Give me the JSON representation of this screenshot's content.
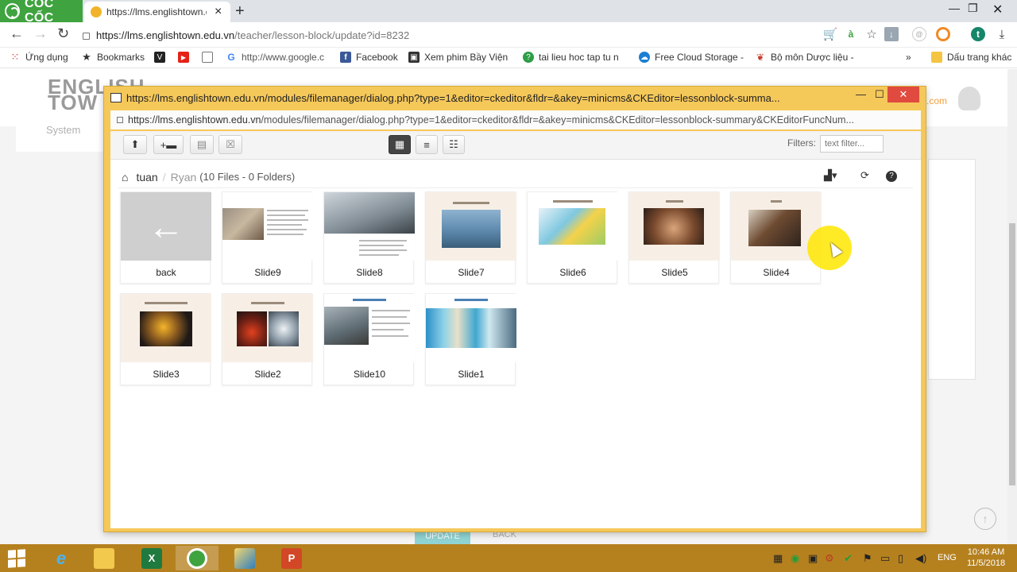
{
  "browser": {
    "brand": "CỐC CỐC",
    "tab_title": "https://lms.englishtown.e",
    "url_host": "https://lms.englishtown.edu.vn",
    "url_path": "/teacher/lesson-block/update?id=8232",
    "account_initial": "t",
    "cart_letter": "à"
  },
  "bookmarks": [
    {
      "label": "Ứng dụng",
      "icon": "apps-grid-icon"
    },
    {
      "label": "Bookmarks",
      "icon": "star-icon"
    },
    {
      "label": "",
      "icon": "v-logo-icon"
    },
    {
      "label": "",
      "icon": "youtube-icon"
    },
    {
      "label": "",
      "icon": "page-icon"
    },
    {
      "label": "http://www.google.c",
      "icon": "google-icon"
    },
    {
      "label": "Facebook",
      "icon": "facebook-icon"
    },
    {
      "label": "Xem phim Bầy Viện",
      "icon": "video-icon"
    },
    {
      "label": "tai lieu hoc tap tu n",
      "icon": "green-circle-icon"
    },
    {
      "label": "Free Cloud Storage -",
      "icon": "cloud-icon"
    },
    {
      "label": "Bộ môn Dược liệu -",
      "icon": "leaf-icon"
    },
    {
      "label": "Dấu trang khác",
      "icon": "folder-icon"
    }
  ],
  "background_page": {
    "logo_line1": "ENGLISH",
    "logo_line2": "TOW",
    "menu_system": "System",
    "domain_fragment": ".com",
    "update_label": "UPDATE",
    "back_label": "BACK"
  },
  "popup": {
    "title": "https://lms.englishtown.edu.vn/modules/filemanager/dialog.php?type=1&editor=ckeditor&fldr=&akey=minicms&CKEditor=lessonblock-summa...",
    "url_host": "https://lms.englishtown.edu.vn",
    "url_path": "/modules/filemanager/dialog.php?type=1&editor=ckeditor&fldr=&akey=minicms&CKEditor=lessonblock-summary&CKEditorFuncNum..."
  },
  "filemanager": {
    "filters_label": "Filters:",
    "filter_placeholder": "text filter...",
    "breadcrumb_parent": "tuan",
    "breadcrumb_current": "Ryan",
    "counts": "(10 Files - 0 Folders)",
    "view_mode": "grid",
    "files": [
      {
        "name": "back"
      },
      {
        "name": "Slide9"
      },
      {
        "name": "Slide8"
      },
      {
        "name": "Slide7"
      },
      {
        "name": "Slide6"
      },
      {
        "name": "Slide5"
      },
      {
        "name": "Slide4"
      },
      {
        "name": "Slide3"
      },
      {
        "name": "Slide2"
      },
      {
        "name": "Slide10"
      },
      {
        "name": "Slide1"
      }
    ]
  },
  "taskbar": {
    "apps": [
      "internet-explorer",
      "file-explorer",
      "excel",
      "coccoc-browser",
      "paint-app",
      "powerpoint"
    ],
    "active_app": "coccoc-browser",
    "language": "ENG",
    "time": "10:46 AM",
    "date": "11/5/2018"
  },
  "colors": {
    "popup_frame": "#f5c85a",
    "close_button": "#e04a3f",
    "taskbar": "#b5811f",
    "brand_green": "#3fa33f"
  }
}
